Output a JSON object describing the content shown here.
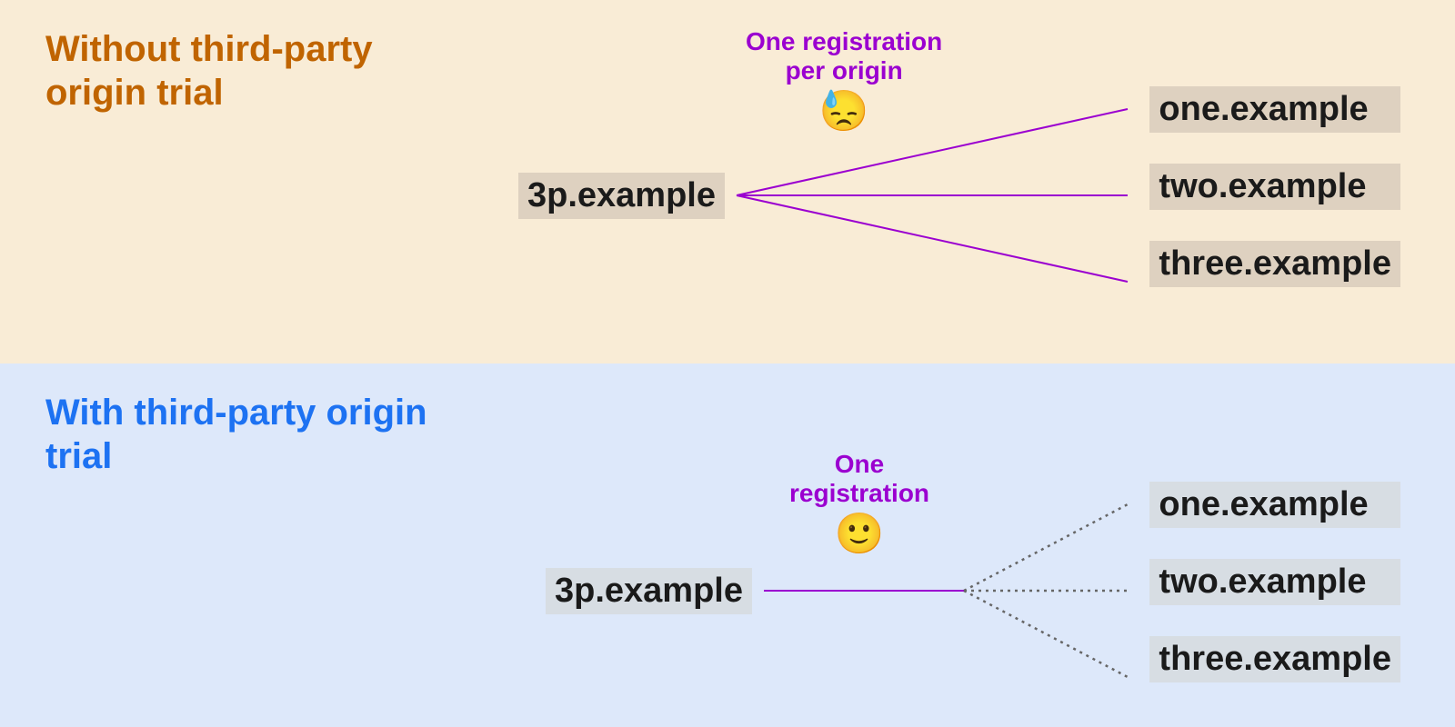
{
  "top": {
    "title": "Without third-party origin trial",
    "source": "3p.example",
    "annotation": "One registration\nper origin",
    "emoji": "😓",
    "targets": [
      "one.example",
      "two.example",
      "three.example"
    ]
  },
  "bottom": {
    "title": "With third-party origin trial",
    "source": "3p.example",
    "annotation": "One\nregistration",
    "emoji": "🙂",
    "targets": [
      "one.example",
      "two.example",
      "three.example"
    ]
  },
  "colors": {
    "top_bg": "#f9ecd6",
    "bottom_bg": "#dde8fa",
    "top_title": "#c06400",
    "bottom_title": "#1d72f2",
    "line_purple": "#9b00d0",
    "line_gray": "#666666"
  }
}
